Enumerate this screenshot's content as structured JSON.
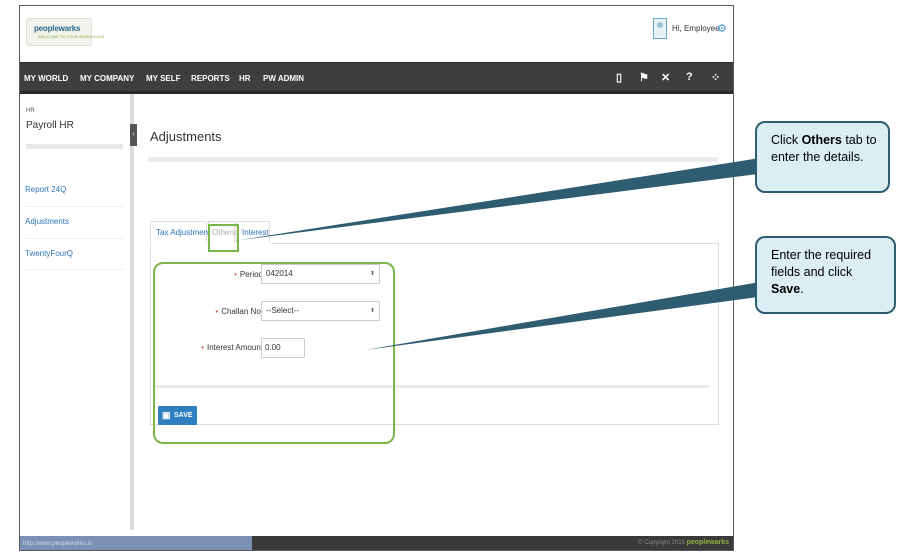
{
  "header": {
    "logo_text": "peoplewarks",
    "logo_tagline": "WELCOME TO YOUR WORKPLACE",
    "greeting": "Hi, Employee"
  },
  "nav": {
    "items": [
      "MY WORLD",
      "MY COMPANY",
      "MY SELF",
      "REPORTS",
      "HR",
      "PW ADMIN"
    ],
    "icons": [
      {
        "name": "book-icon",
        "glyph": "📖"
      },
      {
        "name": "pin-icon",
        "glyph": "📌"
      },
      {
        "name": "tools-icon",
        "glyph": "✂"
      },
      {
        "name": "help-icon",
        "glyph": "?"
      },
      {
        "name": "share-icon",
        "glyph": "⋮"
      }
    ]
  },
  "sidebar": {
    "section": "HR",
    "title": "Payroll HR",
    "links": [
      "Report 24Q",
      "Adjustments",
      "TwentyFourQ"
    ],
    "collapse_glyph": "‹"
  },
  "main": {
    "title": "Adjustments",
    "tabs": [
      "Tax Adjustment",
      "Others",
      "Interest"
    ],
    "form": {
      "period_label": "Period",
      "period_value": "042014",
      "challan_label": "Challan No.",
      "challan_value": "--Select--",
      "interest_label": "Interest Amount",
      "interest_value": "0.00",
      "required_marker": "•",
      "save_label": "SAVE"
    }
  },
  "footer": {
    "url": "http://www.peopleworks.in",
    "copyright": "© Copyright 2015",
    "brand": "peoplewarks"
  },
  "callouts": {
    "others": {
      "pre": "Click ",
      "bold": "Others",
      "post": " tab to enter the details."
    },
    "save": {
      "pre": "Enter the required fields and click ",
      "bold": "Save",
      "post": "."
    }
  },
  "colors": {
    "nav_bg": "#3e3e3e",
    "link_blue": "#2c74b6",
    "save_button": "#2f80c1",
    "highlight_green": "#7ab648",
    "callout_fill": "#daeef3",
    "callout_border": "#2e5d72"
  }
}
